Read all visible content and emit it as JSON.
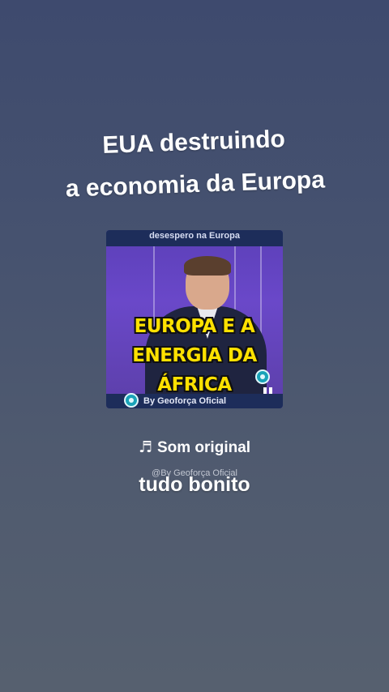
{
  "headline": {
    "line1": "EUA destruindo",
    "line2": "a economia da Europa"
  },
  "thumbnail": {
    "top_text": "desespero na Europa",
    "caption_lines": [
      "EUROPA E A",
      "ENERGIA DA",
      "ÁFRICA"
    ],
    "bottom_text": "By Geoforça Oficial"
  },
  "audio": {
    "icon": "music-note-icon",
    "label": "Som original"
  },
  "watermark": "@By Geoforça Oficial",
  "subtitle": "tudo bonito"
}
